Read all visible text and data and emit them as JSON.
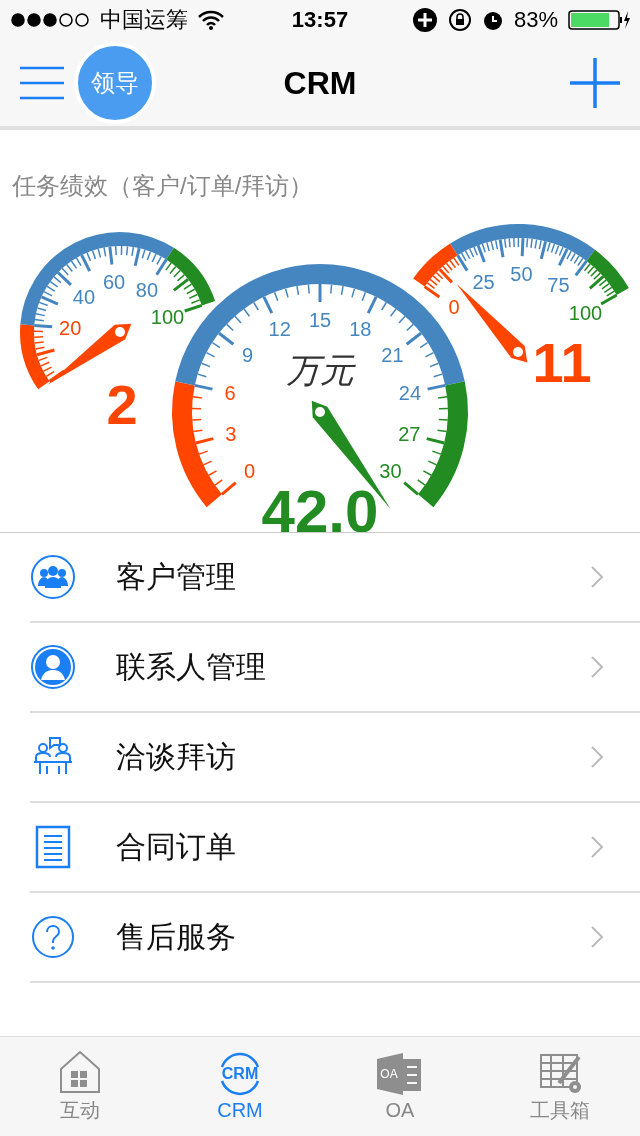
{
  "status_bar": {
    "carrier": "中国运筹",
    "time": "13:57",
    "battery_text": "83%",
    "battery": {
      "level": 0.83
    }
  },
  "nav_bar": {
    "avatar_label": "领导",
    "title": "CRM"
  },
  "performance": {
    "title": "任务绩效（客户/订单/拜访）",
    "gauges": [
      {
        "labels": [
          "20",
          "40",
          "60",
          "80",
          "100"
        ],
        "value": "2"
      },
      {
        "labels": [
          "0",
          "3",
          "6",
          "9",
          "12",
          "15",
          "18",
          "21",
          "24",
          "27",
          "30"
        ],
        "unit": "万元",
        "value": "42.0"
      },
      {
        "labels": [
          "0",
          "25",
          "50",
          "75",
          "100"
        ],
        "value": "11"
      }
    ]
  },
  "menu": [
    {
      "kind": "customers",
      "label": "客户管理"
    },
    {
      "kind": "contact",
      "label": "联系人管理"
    },
    {
      "kind": "meeting",
      "label": "洽谈拜访"
    },
    {
      "kind": "order",
      "label": "合同订单"
    },
    {
      "kind": "service",
      "label": "售后服务"
    }
  ],
  "tab_bar": [
    {
      "kind": "home",
      "label": "互动",
      "selected": false
    },
    {
      "kind": "crm",
      "icon_text": "CRM",
      "label": "CRM",
      "selected": true
    },
    {
      "kind": "oa",
      "icon_text": "OA",
      "label": "OA",
      "selected": false
    },
    {
      "kind": "tools",
      "label": "工具箱",
      "selected": false
    }
  ]
}
